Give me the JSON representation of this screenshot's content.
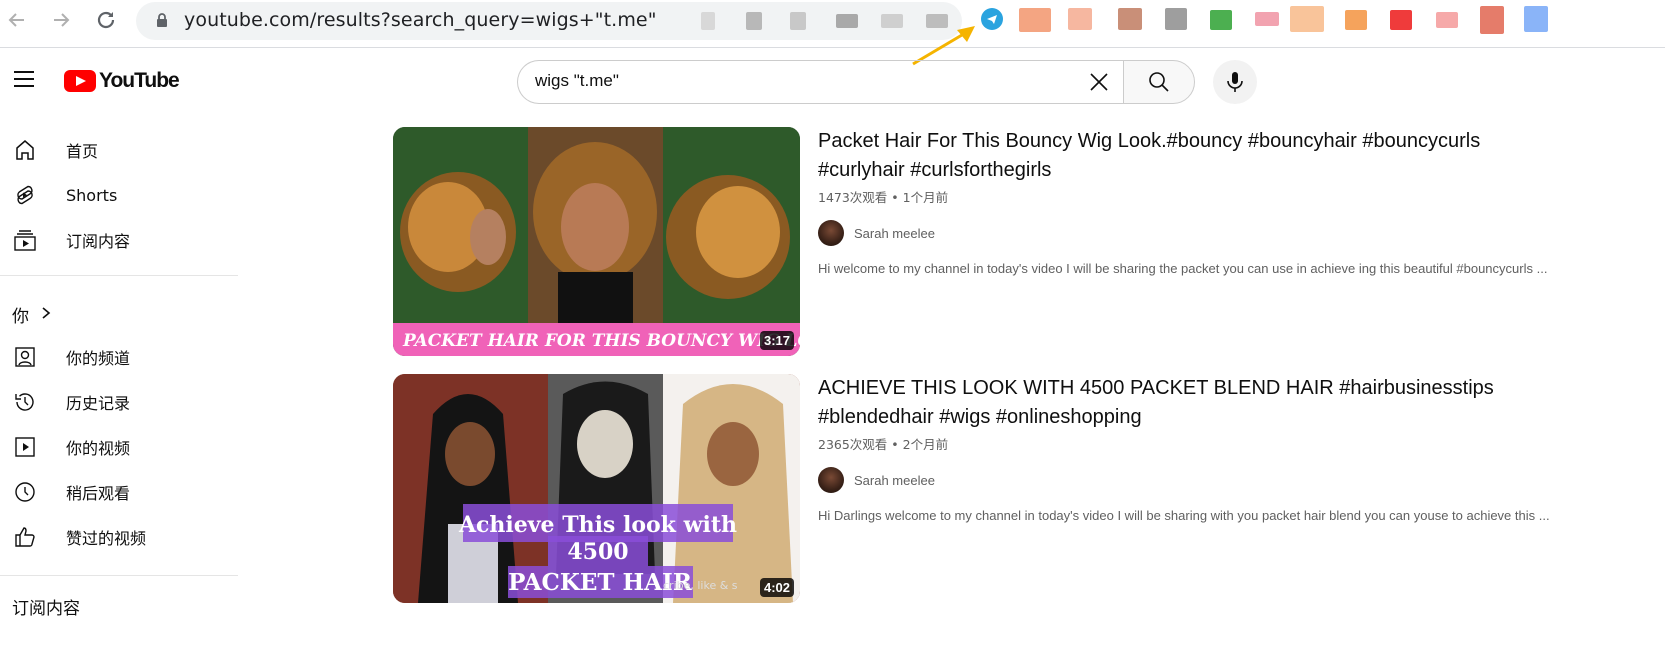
{
  "browser": {
    "url": "youtube.com/results?search_query=wigs+\"t.me\"",
    "blurred_colors": [
      "#d8d8d8",
      "#b8b8b8",
      "#c8c8c8",
      "#a9a9a9",
      "#cfcfcf",
      "#bdbdbd"
    ],
    "extension_colors": [
      "#f4a582",
      "#f6b7a0",
      "#c98f78",
      "#9e9e9e",
      "#4caf50",
      "#f2a3b0",
      "#f9c49a",
      "#f5a35c",
      "#ef3b3b",
      "#f6a9a9",
      "#e57c6a",
      "#8ab4f8"
    ],
    "accent_arrow": "#f5b400",
    "telegram_color": "#2aa3df"
  },
  "header": {
    "logo_text": "YouTube",
    "search_value": "wigs \"t.me\""
  },
  "sidebar": {
    "items": [
      {
        "label": "首页"
      },
      {
        "label": "Shorts"
      },
      {
        "label": "订阅内容"
      }
    ],
    "you_section": "你",
    "you_items": [
      {
        "label": "你的频道"
      },
      {
        "label": "历史记录"
      },
      {
        "label": "你的视频"
      },
      {
        "label": "稍后观看"
      },
      {
        "label": "赞过的视频"
      }
    ],
    "subscriptions_heading": "订阅内容"
  },
  "results": [
    {
      "title_line1": "Packet Hair For This Bouncy Wig Look.#bouncy #bouncyhair #bouncycurls",
      "title_line2": "#curlyhair #curlsforthegirls",
      "stats": "1473次观看 • 1个月前",
      "channel": "Sarah meelee",
      "description": "Hi welcome to my channel in today's video I will be sharing the packet you can use in achieve ing this beautiful #bouncycurls ...",
      "duration": "3:17",
      "thumb_banner": "PACKET HAIR FOR THIS BOUNCY WIG LO"
    },
    {
      "title_line1": "ACHIEVE THIS LOOK WITH 4500 PACKET BLEND HAIR #hairbusinesstips",
      "title_line2": "#blendedhair #wigs #onlineshopping",
      "stats": "2365次观看 • 2个月前",
      "channel": "Sarah meelee",
      "description": "Hi Darlings welcome to my channel in today's video I will be sharing with you packet hair blend you can youse to achieve this ...",
      "duration": "4:02",
      "thumb_text_1": "Achieve This look with",
      "thumb_text_2": "4500",
      "thumb_text_3": "PACKET HAIR",
      "thumb_small": "cribe, like & s"
    }
  ]
}
